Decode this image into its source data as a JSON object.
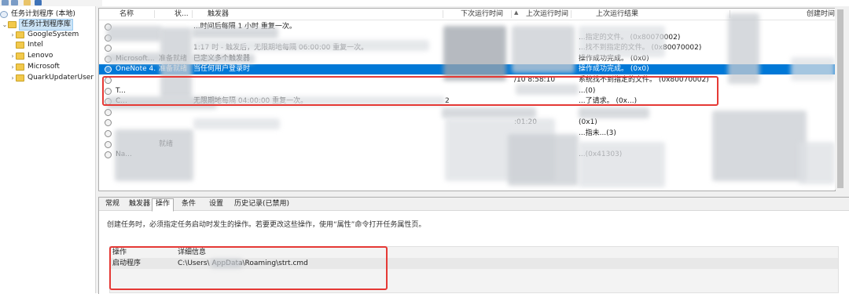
{
  "toolbar": {
    "icons": [
      "back-arrow-icon",
      "forward-arrow-icon",
      "folder-icon",
      "help-icon"
    ]
  },
  "tree": {
    "root": "任务计划程序 (本地)",
    "library": "任务计划程序库",
    "folders": [
      "GoogleSystem",
      "Intel",
      "Lenovo",
      "Microsoft",
      "QuarkUpdaterUser"
    ]
  },
  "task_list": {
    "columns": [
      "名称",
      "状...",
      "触发器",
      "下次运行时间",
      "上次运行时间",
      "上次运行结果",
      "创建时间"
    ],
    "rows": [
      {
        "name": "",
        "status": "",
        "trigger": "...时间后每隔 1 小时 重复一次。",
        "next": "",
        "last": "",
        "result": ""
      },
      {
        "name": "",
        "status": "",
        "trigger": "",
        "next": "",
        "last": "",
        "result": "...指定的文件。 (0x80070002)"
      },
      {
        "name": "",
        "status": "",
        "trigger": "1:17 时 - 触发后，无限期地每隔 06:00:00 重复一次。",
        "next": "",
        "last": "",
        "result": "...找不到指定的文件。 (0x80070002)"
      },
      {
        "name": "Microsoft...",
        "status": "准备就绪",
        "trigger": "已定义多个触发器",
        "next": "",
        "last": "",
        "result": "操作成功完成。 (0x0)"
      },
      {
        "name": "OneNote 4...",
        "status": "准备就绪",
        "trigger": "当任何用户登录时",
        "next": "",
        "last": "",
        "result": "操作成功完成。 (0x0)"
      },
      {
        "name": "",
        "status": "",
        "trigger": "",
        "next": "",
        "last": "/10 8:58:10",
        "result": "系统找不到指定的文件。 (0x80070002)"
      },
      {
        "name": "T...",
        "status": "",
        "trigger": "",
        "next": "",
        "last": "",
        "result": "...(0)"
      },
      {
        "name": "C...",
        "status": "",
        "trigger": "无限期地每隔 04:00:00 重复一次。",
        "next": "2",
        "last": "",
        "result": "...了请求。 (0x...)"
      },
      {
        "name": "",
        "status": "",
        "trigger": "",
        "next": "",
        "last": "",
        "result": ""
      },
      {
        "name": "",
        "status": "",
        "trigger": "",
        "next": "",
        "last": ":01:20",
        "result": "(0x1)"
      },
      {
        "name": "",
        "status": "",
        "trigger": "",
        "next": "",
        "last": "",
        "result": "...指未...(3)"
      },
      {
        "name": "",
        "status": "就绪",
        "trigger": "",
        "next": "",
        "last": "",
        "result": ""
      },
      {
        "name": "Na...",
        "status": "",
        "trigger": "",
        "next": "",
        "last": "",
        "result": "...(0x41303)"
      }
    ],
    "selected_index": 4
  },
  "details": {
    "tabs": [
      "常规",
      "触发器",
      "操作",
      "条件",
      "设置",
      "历史记录(已禁用)"
    ],
    "active_tab": "操作",
    "description": "创建任务时，必须指定任务启动时发生的操作。若要更改这些操作，使用“属性”命令打开任务属性页。",
    "actions_table": {
      "columns": [
        "操作",
        "详细信息"
      ],
      "rows": [
        {
          "action": "启动程序",
          "detail": "C:\\Users\\        AppData\\Roaming\\strt.cmd"
        }
      ]
    }
  },
  "colors": {
    "selection": "#0078d7",
    "highlight_box": "#e53935",
    "folder": "#f2c94c"
  }
}
